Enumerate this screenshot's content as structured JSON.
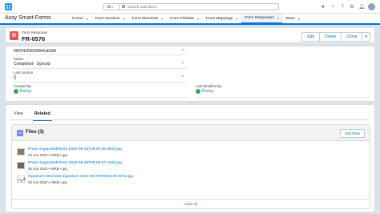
{
  "header": {
    "search_scope": "All",
    "search_placeholder": "Search Salesforce"
  },
  "navbar": {
    "app_name": "Axsy Smart Forms",
    "items": [
      {
        "label": "Forms"
      },
      {
        "label": "Form Sections"
      },
      {
        "label": "Form Elements"
      },
      {
        "label": "Form Picklists"
      },
      {
        "label": "Form Mappings"
      },
      {
        "label": "Form Responses"
      },
      {
        "label": "More"
      }
    ]
  },
  "record": {
    "type_label": "Form Response",
    "name": "FR-0576",
    "buttons": {
      "edit": "Edit",
      "delete": "Delete",
      "clone": "Clone"
    }
  },
  "details": {
    "id_value": "0WO4J000000hKsEWA",
    "status_label": "Status",
    "status_value": "Completed - Synced",
    "last_section_label": "Last Section",
    "last_section_value": "{}",
    "created_by_label": "Created By",
    "created_by_value": "Penny",
    "modified_by_label": "Last Modified By",
    "modified_by_value": "Penny"
  },
  "tabs": [
    {
      "label": "View"
    },
    {
      "label": "Related"
    }
  ],
  "files": {
    "title": "Files (3)",
    "add_label": "Add Files",
    "items": [
      {
        "name": "Photo-SupportedFiles1-2020-06-26T09:00:38.392Z.jpg",
        "meta": "26 Jun 2020 • 83KB • jpg"
      },
      {
        "name": "Photo-SupportedFiles1-2020-06-26T09:08:37.210Z.jpg",
        "meta": "26 Jun 2020 • 90KB • jpg"
      },
      {
        "name": "Signature-MechanicSignature-2020-06-26T08:56:09.007Z.jpg",
        "meta": "26 Jun 2020 • 26KB • jpg"
      }
    ],
    "view_all": "View All"
  }
}
